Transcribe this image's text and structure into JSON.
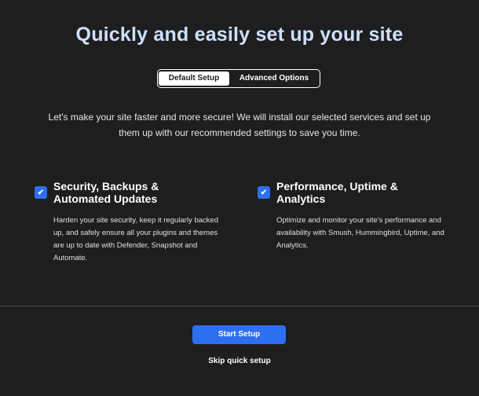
{
  "page_title": "Quickly and easily set up your site",
  "toggle": {
    "options": [
      "Default Setup",
      "Advanced Options"
    ],
    "selected": "Default Setup"
  },
  "intro": "Let's make your site faster and more secure! We will install our selected services and set up them up with our recommended settings to save you time.",
  "features": [
    {
      "checked": true,
      "title": "Security, Backups & Automated Updates",
      "description": "Harden your site security, keep it regularly backed up, and safely ensure all your plugins and themes are up to date with Defender, Snapshot and Automate."
    },
    {
      "checked": true,
      "title": "Performance, Uptime & Analytics",
      "description": "Optimize and monitor your site's performance and availability with Smush, Hummingbird, Uptime, and Analytics."
    }
  ],
  "actions": {
    "start_label": "Start Setup",
    "skip_label": "Skip quick setup"
  },
  "colors": {
    "background": "#1e1e1f",
    "title": "#cde0ff",
    "accent": "#2d6ff0"
  },
  "icons": {
    "checkbox": "checkmark-icon"
  }
}
